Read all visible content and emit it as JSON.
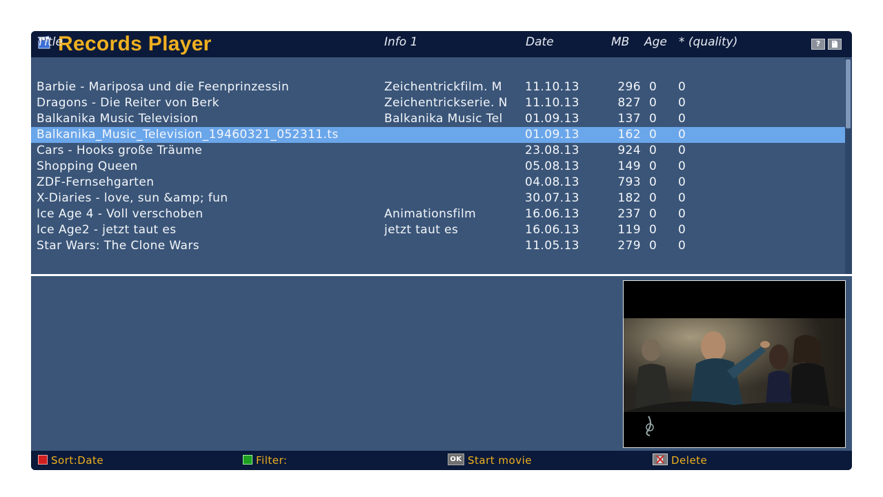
{
  "window": {
    "title": "Records Player"
  },
  "titlebar_buttons": {
    "help": "?",
    "info": ""
  },
  "columns": {
    "title": "Title",
    "info": "Info 1",
    "date": "Date",
    "mb": "MB",
    "age": "Age",
    "quality": "* (quality)"
  },
  "rows": [
    {
      "title": "Barbie - Mariposa und die Feenprinzessin",
      "info": "Zeichentrickfilm. M",
      "date": "11.10.13",
      "mb": "296",
      "age": "0",
      "quality": "0",
      "selected": false
    },
    {
      "title": "Dragons - Die Reiter von Berk",
      "info": "Zeichentrickserie. N",
      "date": "11.10.13",
      "mb": "827",
      "age": "0",
      "quality": "0",
      "selected": false
    },
    {
      "title": "Balkanika Music Television",
      "info": "Balkanika Music Tel",
      "date": "01.09.13",
      "mb": "137",
      "age": "0",
      "quality": "0",
      "selected": false
    },
    {
      "title": "Balkanika_Music_Television_19460321_052311.ts",
      "info": "",
      "date": "01.09.13",
      "mb": "162",
      "age": "0",
      "quality": "0",
      "selected": true
    },
    {
      "title": "Cars - Hooks große Träume",
      "info": "",
      "date": "23.08.13",
      "mb": "924",
      "age": "0",
      "quality": "0",
      "selected": false
    },
    {
      "title": "Shopping Queen",
      "info": "",
      "date": "05.08.13",
      "mb": "149",
      "age": "0",
      "quality": "0",
      "selected": false
    },
    {
      "title": "ZDF-Fernsehgarten",
      "info": "",
      "date": "04.08.13",
      "mb": "793",
      "age": "0",
      "quality": "0",
      "selected": false
    },
    {
      "title": "X-Diaries - love, sun &amp; fun",
      "info": "",
      "date": "30.07.13",
      "mb": "182",
      "age": "0",
      "quality": "0",
      "selected": false
    },
    {
      "title": "Ice Age 4 - Voll verschoben",
      "info": "Animationsfilm",
      "date": "16.06.13",
      "mb": "237",
      "age": "0",
      "quality": "0",
      "selected": false
    },
    {
      "title": "Ice Age2 - jetzt taut es",
      "info": "jetzt taut es",
      "date": "16.06.13",
      "mb": "119",
      "age": "0",
      "quality": "0",
      "selected": false
    },
    {
      "title": "Star Wars: The Clone Wars",
      "info": "",
      "date": "11.05.13",
      "mb": "279",
      "age": "0",
      "quality": "0",
      "selected": false
    }
  ],
  "footer": {
    "sort_label": "Sort:Date",
    "filter_label": "Filter:",
    "ok_key": "OK",
    "ok_label": "Start movie",
    "delete_label": "Delete"
  },
  "colors": {
    "accent": "#f0b020",
    "panel": "#3a5578",
    "bar": "#0b1a3a",
    "selection": "#6aa6ea"
  }
}
